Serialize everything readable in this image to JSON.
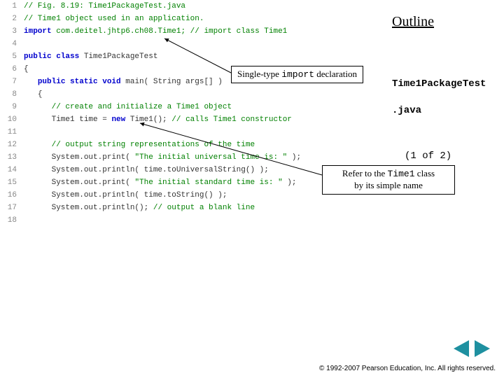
{
  "outline": "Outline",
  "file": {
    "title": "Time1PackageTest",
    "ext": ".java"
  },
  "page_counter": "(1 of 2)",
  "callouts": {
    "import_pre": "Single-type ",
    "import_kw": "import",
    "import_post": " declaration",
    "refer_pre": "Refer to the ",
    "refer_class": "Time1",
    "refer_post": " class",
    "refer_line2": "by its simple name"
  },
  "footer": "© 1992-2007 Pearson Education, Inc.  All rights reserved.",
  "code": {
    "l1": {
      "n": "1",
      "t": "// Fig. 8.19: Time1PackageTest.java"
    },
    "l2": {
      "n": "2",
      "t": "// Time1 object used in an application."
    },
    "l3": {
      "n": "3",
      "imp": "import",
      "rest": " com.deitel.jhtp6.ch08.Time1; ",
      "cm": "// import class Time1"
    },
    "l4": {
      "n": "4"
    },
    "l5": {
      "n": "5",
      "k1": "public class",
      "id": " Time1PackageTest"
    },
    "l6": {
      "n": "6",
      "t": "{"
    },
    "l7": {
      "n": "7",
      "pad": "   ",
      "k1": "public static void",
      "rest": " main( String args[] ) "
    },
    "l8": {
      "n": "8",
      "pad": "   ",
      "t": "{"
    },
    "l9": {
      "n": "9",
      "pad": "      ",
      "cm": "// create and initialize a Time1 object"
    },
    "l10": {
      "n": "10",
      "pad": "      ",
      "a": "Time1 time = ",
      "kw": "new",
      "b": " Time1(); ",
      "cm": "// calls Time1 constructor"
    },
    "l11": {
      "n": "11"
    },
    "l12": {
      "n": "12",
      "pad": "      ",
      "cm": "// output string representations of the time"
    },
    "l13": {
      "n": "13",
      "pad": "      ",
      "a": "System.out.print( ",
      "s": "\"The initial universal time is: \"",
      "b": " );"
    },
    "l14": {
      "n": "14",
      "pad": "      ",
      "a": "System.out.println( time.toUniversalString() );"
    },
    "l15": {
      "n": "15",
      "pad": "      ",
      "a": "System.out.print( ",
      "s": "\"The initial standard time is: \"",
      "b": " );"
    },
    "l16": {
      "n": "16",
      "pad": "      ",
      "a": "System.out.println( time.toString() );"
    },
    "l17": {
      "n": "17",
      "pad": "      ",
      "a": "System.out.println(); ",
      "cm": "// output a blank line"
    },
    "l18": {
      "n": "18"
    }
  }
}
